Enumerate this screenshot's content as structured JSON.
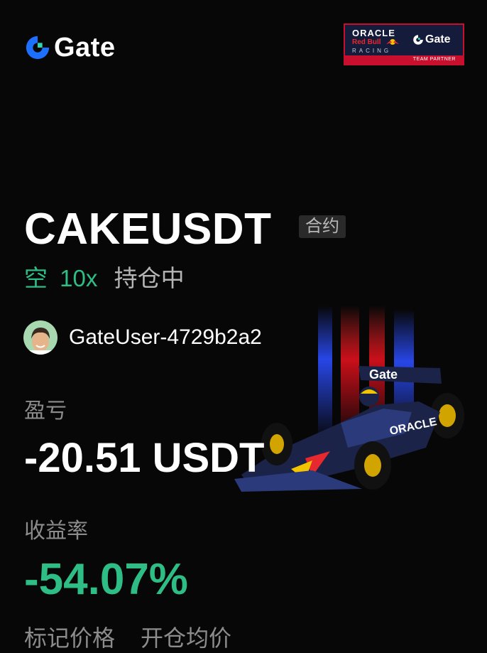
{
  "header": {
    "brand": "Gate",
    "partner_badge": {
      "oracle": "ORACLE",
      "red_bull": "Red Bull",
      "racing": "RACING",
      "gate": "Gate",
      "footer": "TEAM PARTNER"
    }
  },
  "position": {
    "pair": "CAKEUSDT",
    "tag": "合约",
    "side": "空",
    "leverage": "10x",
    "status": "持仓中"
  },
  "user": {
    "name": "GateUser-4729b2a2"
  },
  "pnl": {
    "label": "盈亏",
    "value": "-20.51 USDT"
  },
  "roi": {
    "label": "收益率",
    "value": "-54.07%"
  },
  "footer_labels": {
    "mark_price": "标记价格",
    "avg_open_price": "开仓均价"
  },
  "colors": {
    "background": "#070707",
    "positive_green": "#2ebd85",
    "muted": "#8c8c8c",
    "tag_bg": "#2a2a2a",
    "brand_blue": "#1d6fff"
  },
  "car_livery": {
    "gate_wing_text": "Gate",
    "sidepod_text": "ORACLE"
  }
}
